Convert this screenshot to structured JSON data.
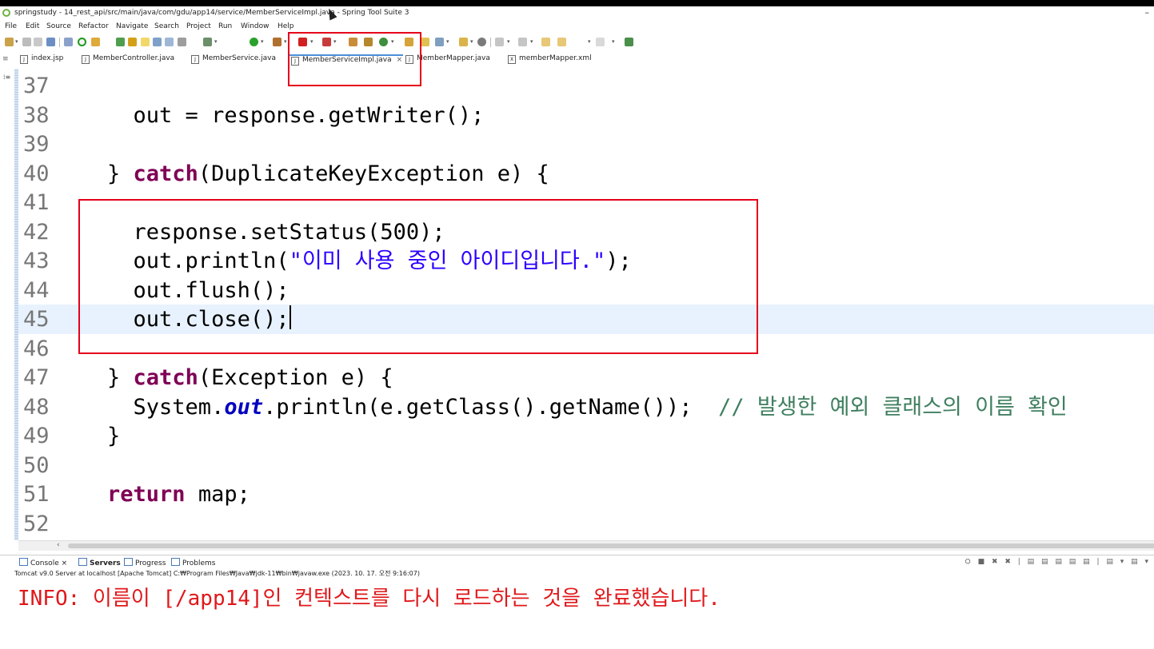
{
  "window": {
    "title": "springstudy - 14_rest_api/src/main/java/com/gdu/app14/service/MemberServiceImpl.java - Spring Tool Suite 3",
    "minimize": "–"
  },
  "menu": [
    "File",
    "Edit",
    "Source",
    "Refactor",
    "Navigate",
    "Search",
    "Project",
    "Run",
    "Window",
    "Help"
  ],
  "tabs": [
    {
      "label": "index.jsp",
      "icon": "jsp-file-icon",
      "active": false
    },
    {
      "label": "MemberController.java",
      "icon": "java-file-icon",
      "active": false
    },
    {
      "label": "MemberService.java",
      "icon": "java-file-icon",
      "active": false
    },
    {
      "label": "MemberServiceImpl.java",
      "icon": "java-file-icon",
      "active": true,
      "close": "×"
    },
    {
      "label": "MemberMapper.java",
      "icon": "java-file-icon",
      "active": false
    },
    {
      "label": "memberMapper.xml",
      "icon": "xml-file-icon",
      "active": false
    }
  ],
  "editor": {
    "lines": [
      {
        "n": "37"
      },
      {
        "n": "38",
        "t1": "      out = response.getWriter();"
      },
      {
        "n": "39"
      },
      {
        "n": "40",
        "t1": "    } ",
        "k": "catch",
        "t2": "(DuplicateKeyException e) {"
      },
      {
        "n": "41"
      },
      {
        "n": "42",
        "t1": "      response.setStatus(500);"
      },
      {
        "n": "43",
        "t1": "      out.println(",
        "s": "\"이미 사용 중인 아이디입니다.\"",
        "t2": ");"
      },
      {
        "n": "44",
        "t1": "      out.flush();"
      },
      {
        "n": "45",
        "t1": "      out.close();",
        "current": true
      },
      {
        "n": "46"
      },
      {
        "n": "47",
        "t1": "    } ",
        "k": "catch",
        "t2": "(Exception e) {"
      },
      {
        "n": "48",
        "t1": "      System.",
        "i": "out",
        "t2": ".println(e.getClass().getName());  ",
        "c": "// 발생한 예외 클래스의 이름 확인"
      },
      {
        "n": "49",
        "t1": "    }"
      },
      {
        "n": "50"
      },
      {
        "n": "51",
        "t1": "    ",
        "k": "return",
        "t2": " map;"
      },
      {
        "n": "52"
      }
    ]
  },
  "console": {
    "tabs": [
      {
        "label": "Console",
        "close": "×"
      },
      {
        "label": "Servers",
        "bold": true
      },
      {
        "label": "Progress"
      },
      {
        "label": "Problems"
      }
    ],
    "description": "Tomcat v9.0 Server at localhost [Apache Tomcat] C:₩Program Files₩Java₩jdk-11₩bin₩javaw.exe  (2023. 10. 17. 오전 9:16:07)",
    "output": "INFO: 이름이 [/app14]인 컨텍스트를 다시 로드하는 것을 완료했습니다."
  },
  "colors": {
    "keyword": "#7f0055",
    "string": "#2a00ff",
    "comment": "#3f7f5f",
    "console_error": "#e0181b",
    "annotation_box": "#e5001a"
  }
}
